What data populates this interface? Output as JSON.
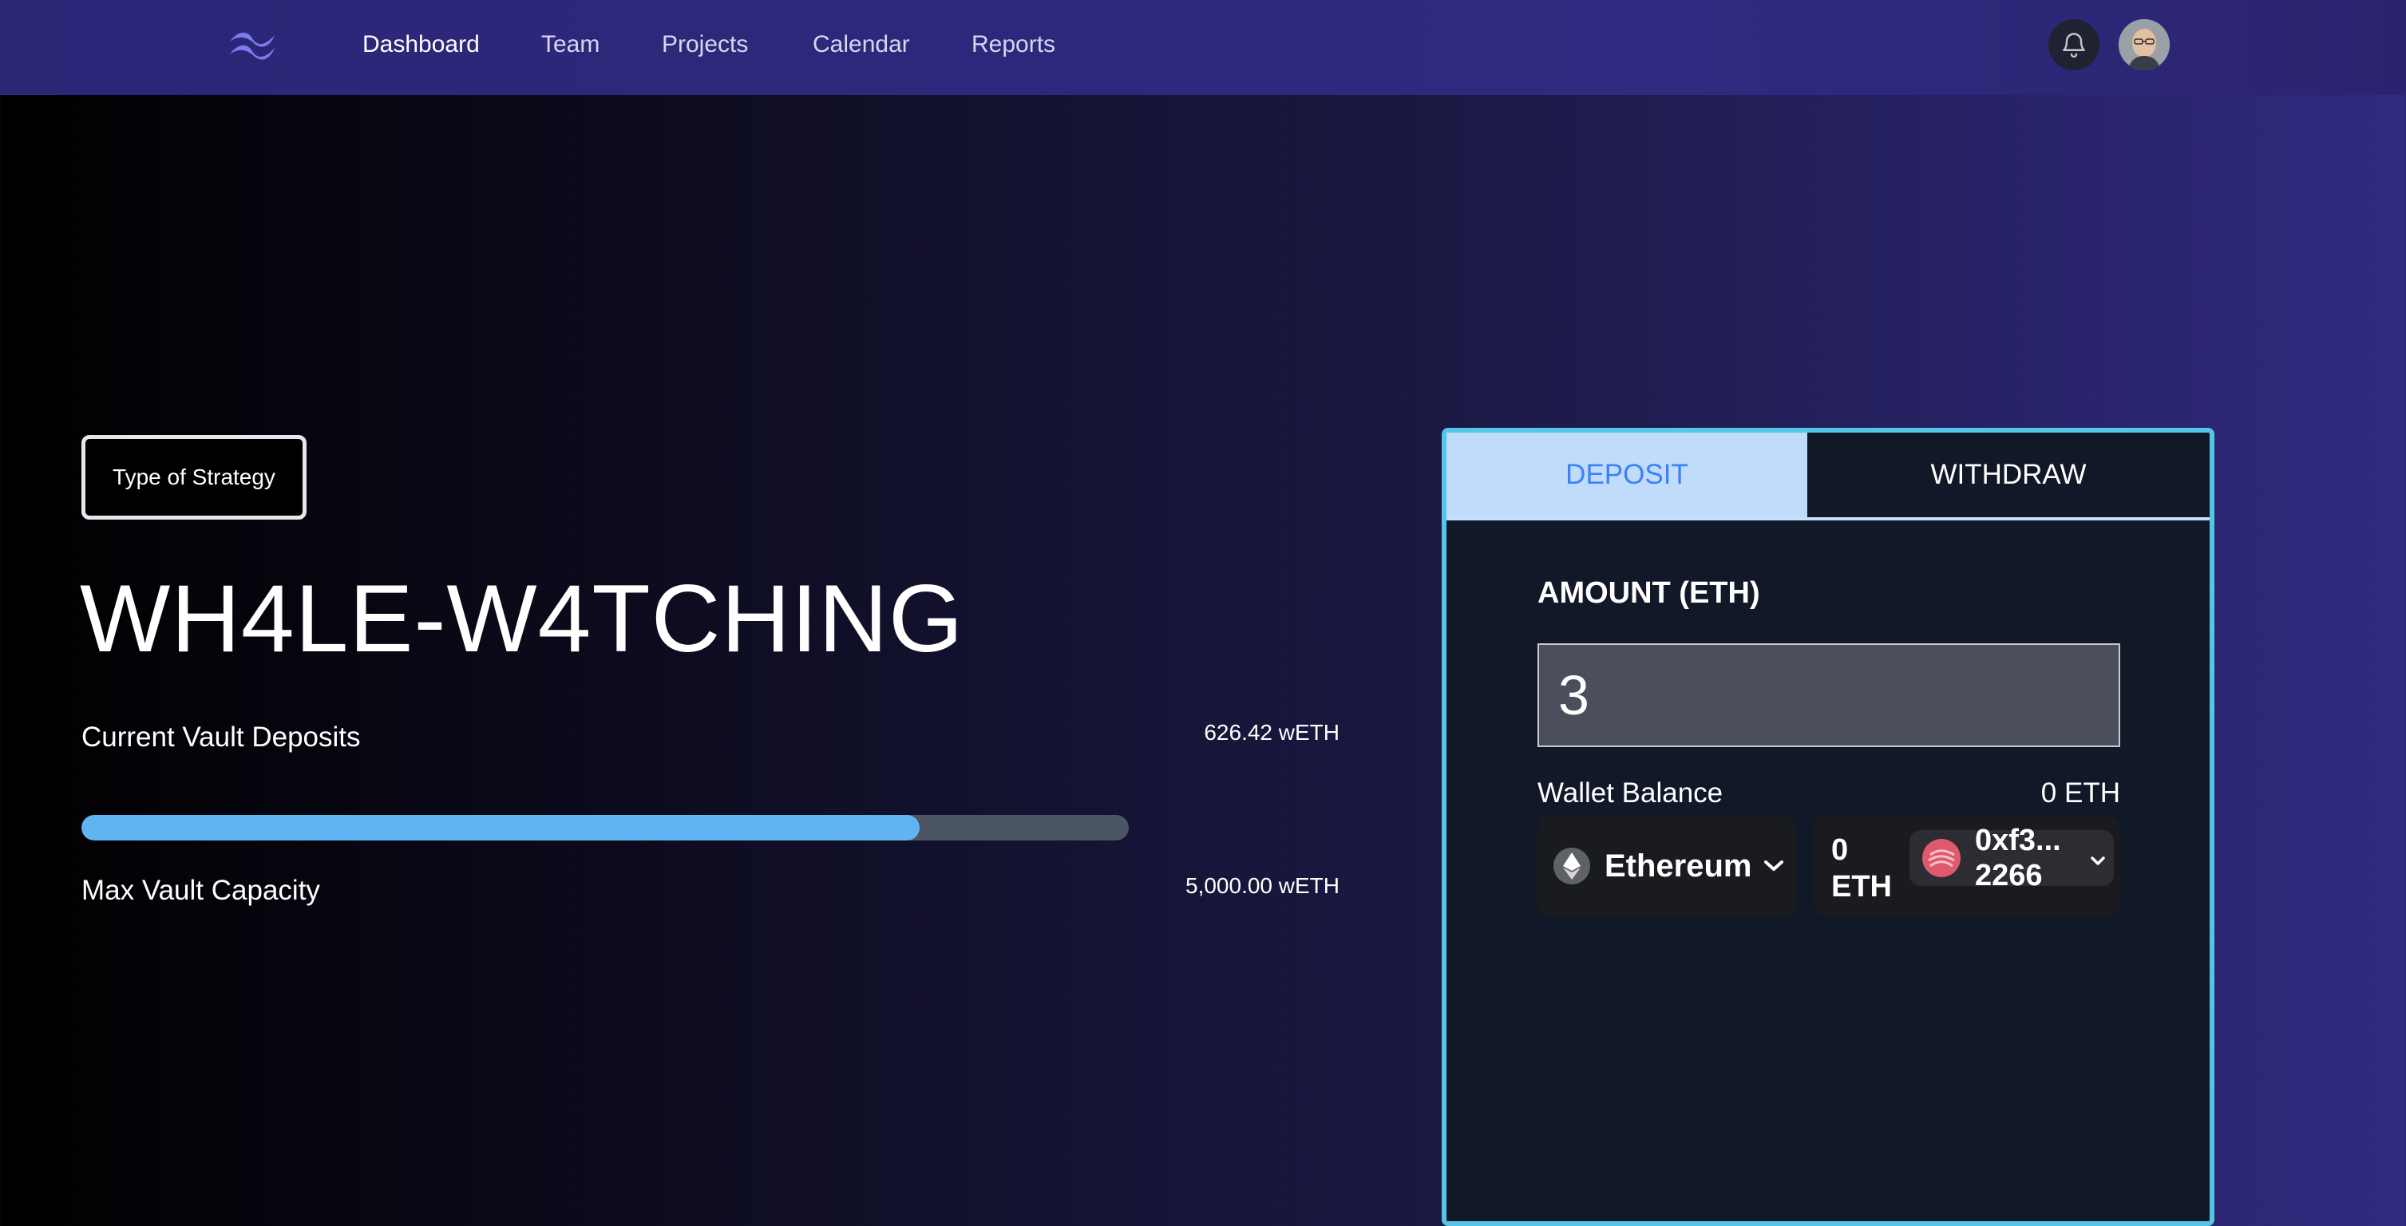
{
  "nav": {
    "logo_icon": "wave-logo-icon",
    "items": [
      {
        "label": "Dashboard",
        "active": true
      },
      {
        "label": "Team",
        "active": false
      },
      {
        "label": "Projects",
        "active": false
      },
      {
        "label": "Calendar",
        "active": false
      },
      {
        "label": "Reports",
        "active": false
      }
    ],
    "notification_icon": "bell-icon",
    "avatar_icon": "user-avatar"
  },
  "vault": {
    "strategy_badge": "Type of Strategy",
    "title": "WH4LE-W4TCHING",
    "current_deposits_label": "Current Vault Deposits",
    "current_deposits_value": "626.42 wETH",
    "max_capacity_label": "Max Vault Capacity",
    "max_capacity_value": "5,000.00 wETH",
    "fill_fraction": 0.8
  },
  "panel": {
    "tabs": [
      {
        "label": "DEPOSIT",
        "active": true
      },
      {
        "label": "WITHDRAW",
        "active": false
      }
    ],
    "amount_label": "AMOUNT (ETH)",
    "amount_value": "3",
    "wallet_balance_label": "Wallet Balance",
    "wallet_balance_value": "0 ETH",
    "chain": {
      "name": "Ethereum",
      "icon": "ethereum-icon"
    },
    "account": {
      "balance": "0 ETH",
      "address_line1": "0xf3...",
      "address_line2": "2266",
      "icon": "account-avatar-icon"
    }
  },
  "colors": {
    "accent_blue": "#60b4f2",
    "panel_border": "#55c5e8",
    "tab_active_bg": "#c1dcfb",
    "tab_active_text": "#3b82f6",
    "nav_bg": "#302a80"
  }
}
